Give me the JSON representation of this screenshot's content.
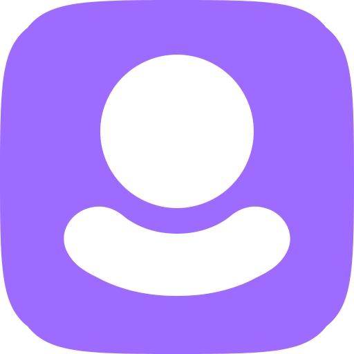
{
  "icon": {
    "name": "user-profile-app-icon",
    "colors": {
      "background": "#9D6BFF",
      "glyph": "#FFFFFF"
    }
  }
}
